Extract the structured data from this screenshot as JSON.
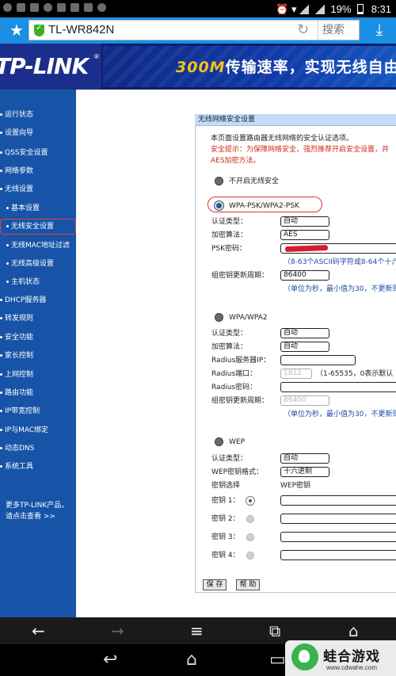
{
  "status_bar": {
    "battery": "19%",
    "time": "8:31"
  },
  "browser": {
    "url_title": "TL-WR842N",
    "search_label": "搜索"
  },
  "banner": {
    "logo": "TP-LINK",
    "slogan_highlight": "300M",
    "slogan_rest": "传输速率，实现无线自由"
  },
  "sidebar": {
    "items": [
      "运行状态",
      "设置向导",
      "QSS安全设置",
      "网络参数",
      "无线设置",
      "基本设置",
      "无线安全设置",
      "无线MAC地址过滤",
      "无线高级设置",
      "主机状态",
      "DHCP服务器",
      "转发规则",
      "安全功能",
      "家长控制",
      "上网控制",
      "路由功能",
      "IP带宽控制",
      "IP与MAC绑定",
      "动态DNS",
      "系统工具"
    ],
    "more_line1": "更多TP-LINK产品，",
    "more_line2": "请点击查看 >>"
  },
  "panel": {
    "title": "无线网络安全设置",
    "intro": "本页面设置路由器无线网络的安全认证选项。",
    "warn1": "安全提示：为保障网络安全，强烈推荐开启安全设置，并",
    "warn2": "AES加密方法。",
    "opt_none": "不开启无线安全",
    "wpa_psk": {
      "label": "WPA-PSK/WPA2-PSK",
      "auth_label": "认证类型：",
      "auth_value": "自动",
      "enc_label": "加密算法：",
      "enc_value": "AES",
      "psk_label": "PSK密码：",
      "psk_hint": "（8-63个ASCII码字符或8-64个十六",
      "renew_label": "组密钥更新周期：",
      "renew_value": "86400",
      "renew_hint": "（单位为秒，最小值为30，不更新则"
    },
    "wpa": {
      "label": "WPA/WPA2",
      "auth_label": "认证类型：",
      "auth_value": "自动",
      "enc_label": "加密算法：",
      "enc_value": "自动",
      "radius_ip_label": "Radius服务器IP：",
      "radius_port_label": "Radius端口：",
      "radius_port_value": "1812",
      "radius_port_hint": "（1-65535，0表示默认",
      "radius_pwd_label": "Radius密码：",
      "renew_label": "组密钥更新周期：",
      "renew_value": "86400",
      "renew_hint": "（单位为秒，最小值为30，不更新则"
    },
    "wep": {
      "label": "WEP",
      "auth_label": "认证类型：",
      "auth_value": "自动",
      "format_label": "WEP密钥格式：",
      "format_value": "十六进制",
      "key_select_label": "密钥选择",
      "key_header": "WEP密钥",
      "key1": "密钥 1：",
      "key2": "密钥 2：",
      "key3": "密钥 3：",
      "key4": "密钥 4："
    },
    "save_button": "保 存",
    "help_button": "帮 助"
  },
  "watermark": {
    "title": "蛙合游戏",
    "url": "www.cdwahe.com"
  }
}
